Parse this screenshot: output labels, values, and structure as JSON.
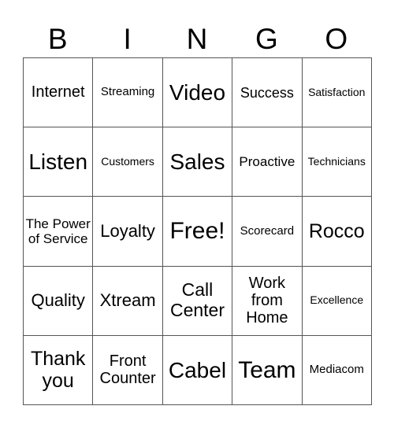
{
  "header": {
    "letters": [
      "B",
      "I",
      "N",
      "G",
      "O"
    ]
  },
  "grid": {
    "rows": [
      [
        "Internet",
        "Streaming",
        "Video",
        "Success",
        "Satisfaction"
      ],
      [
        "Listen",
        "Customers",
        "Sales",
        "Proactive",
        "Technicians"
      ],
      [
        "The Power of Service",
        "Loyalty",
        "Free!",
        "Scorecard",
        "Rocco"
      ],
      [
        "Quality",
        "Xtream",
        "Call Center",
        "Work from Home",
        "Excellence"
      ],
      [
        "Thank you",
        "Front Counter",
        "Cabel",
        "Team",
        "Mediacom"
      ]
    ]
  }
}
